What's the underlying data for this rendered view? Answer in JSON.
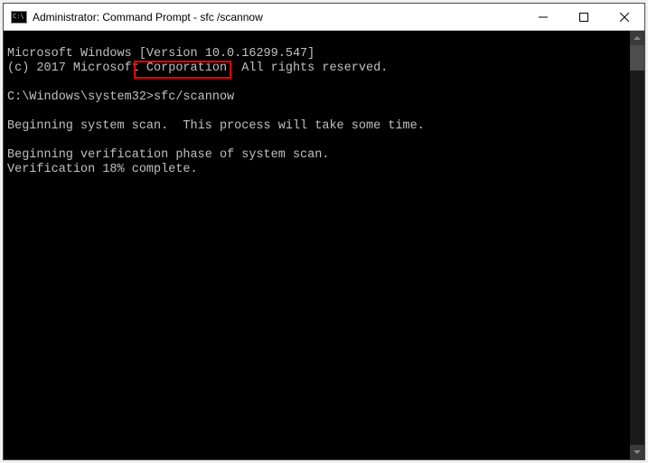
{
  "titlebar": {
    "icon_text": "C:\\",
    "title": "Administrator: Command Prompt - sfc  /scannow"
  },
  "console": {
    "line1": "Microsoft Windows [Version 10.0.16299.547]",
    "line2": "(c) 2017 Microsoft Corporation. All rights reserved.",
    "blank1": "",
    "prompt_prefix": "C:\\Windows\\system32>",
    "prompt_command": "sfc/scannow",
    "blank2": "",
    "line3": "Beginning system scan.  This process will take some time.",
    "blank3": "",
    "line4": "Beginning verification phase of system scan.",
    "line5": "Verification 18% complete."
  }
}
